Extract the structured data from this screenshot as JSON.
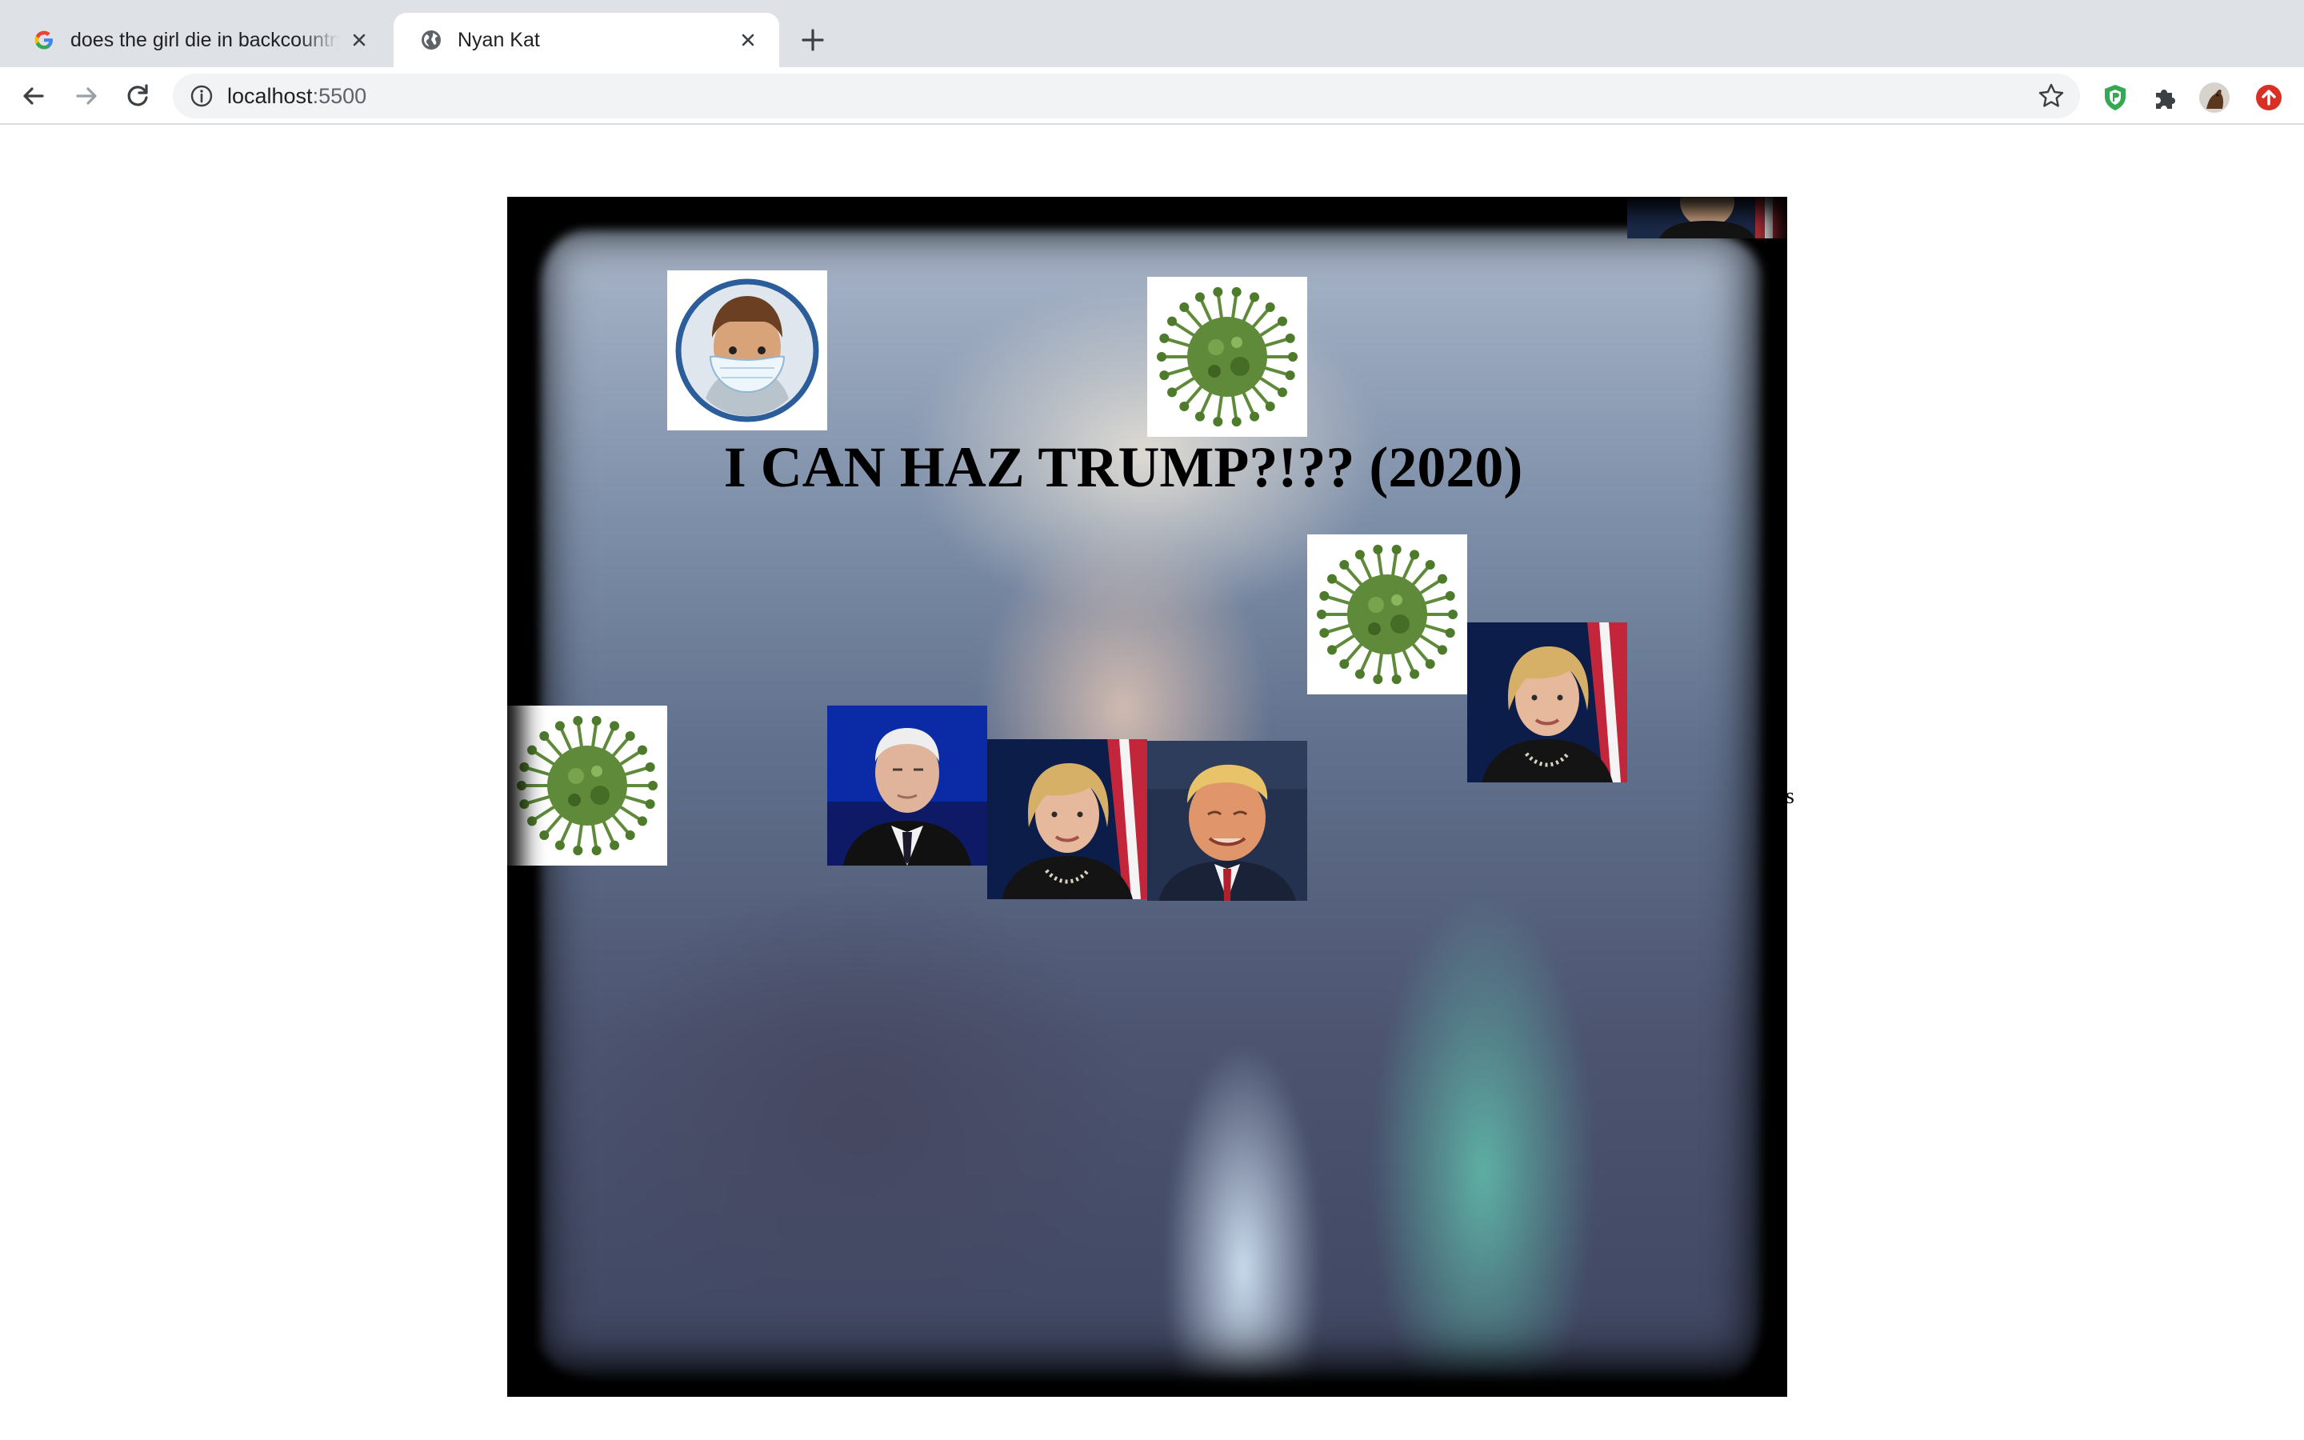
{
  "browser": {
    "tabs": [
      {
        "title": "does the girl die in backcountry",
        "favicon": "google-g-icon",
        "active": false
      },
      {
        "title": "Nyan Kat",
        "favicon": "globe-icon",
        "active": true
      }
    ],
    "new_tab_icon": "plus-icon",
    "address": {
      "host": "localhost",
      "port": ":5500"
    },
    "nav_icons": [
      "back-arrow-icon",
      "forward-arrow-icon",
      "reload-icon"
    ],
    "extension_icons": [
      "shield-extension-icon",
      "puzzle-extensions-icon",
      "profile-avatar",
      "update-icon"
    ]
  },
  "page": {
    "headline": "I CAN HAZ TRUMP?!?? (2020)",
    "stray_text": "s",
    "tiles": [
      {
        "name": "masked-person-tile",
        "kind": "masked-face"
      },
      {
        "name": "virus-tile",
        "kind": "virus"
      },
      {
        "name": "virus-tile",
        "kind": "virus"
      },
      {
        "name": "virus-tile",
        "kind": "virus"
      },
      {
        "name": "hillary-clinton-photo",
        "kind": "hillary"
      },
      {
        "name": "hillary-clinton-photo",
        "kind": "hillary"
      },
      {
        "name": "joe-biden-photo",
        "kind": "biden"
      },
      {
        "name": "donald-trump-photo",
        "kind": "trump"
      },
      {
        "name": "partial-portrait-photo",
        "kind": "partial"
      }
    ]
  },
  "colors": {
    "tabstrip": "#dee1e6",
    "omnibox": "#f1f3f4",
    "virus_green": "#5f8a3a",
    "mask_ring": "#2a5d9a",
    "update_red": "#d93025",
    "shield_green": "#34a853"
  }
}
